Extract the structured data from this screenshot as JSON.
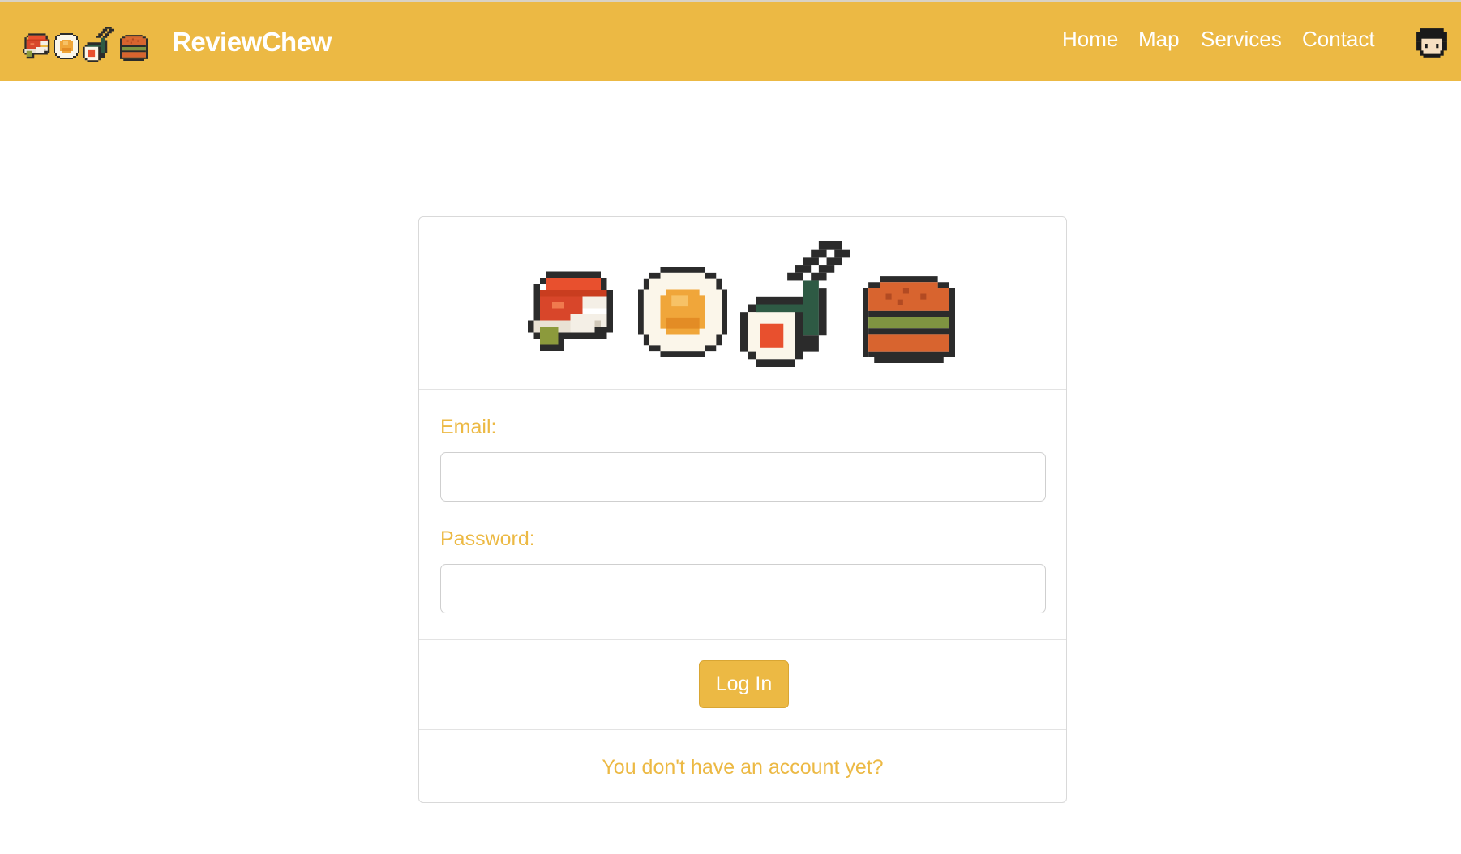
{
  "app": {
    "name": "ReviewChew"
  },
  "colors": {
    "accent": "#ECB944",
    "white": "#ffffff",
    "border": "#d9d9d9"
  },
  "nav": {
    "items": [
      {
        "label": "Home"
      },
      {
        "label": "Map"
      },
      {
        "label": "Services"
      },
      {
        "label": "Contact"
      }
    ],
    "avatar_icon": "user-avatar-icon"
  },
  "icons": {
    "brand": [
      "nigiri-icon",
      "egg-roll-icon",
      "maki-chopsticks-icon",
      "burger-icon"
    ]
  },
  "login_form": {
    "email_label": "Email:",
    "email_value": "",
    "password_label": "Password:",
    "password_value": "",
    "submit_label": "Log In",
    "signup_link": "You don't have an account yet?"
  }
}
